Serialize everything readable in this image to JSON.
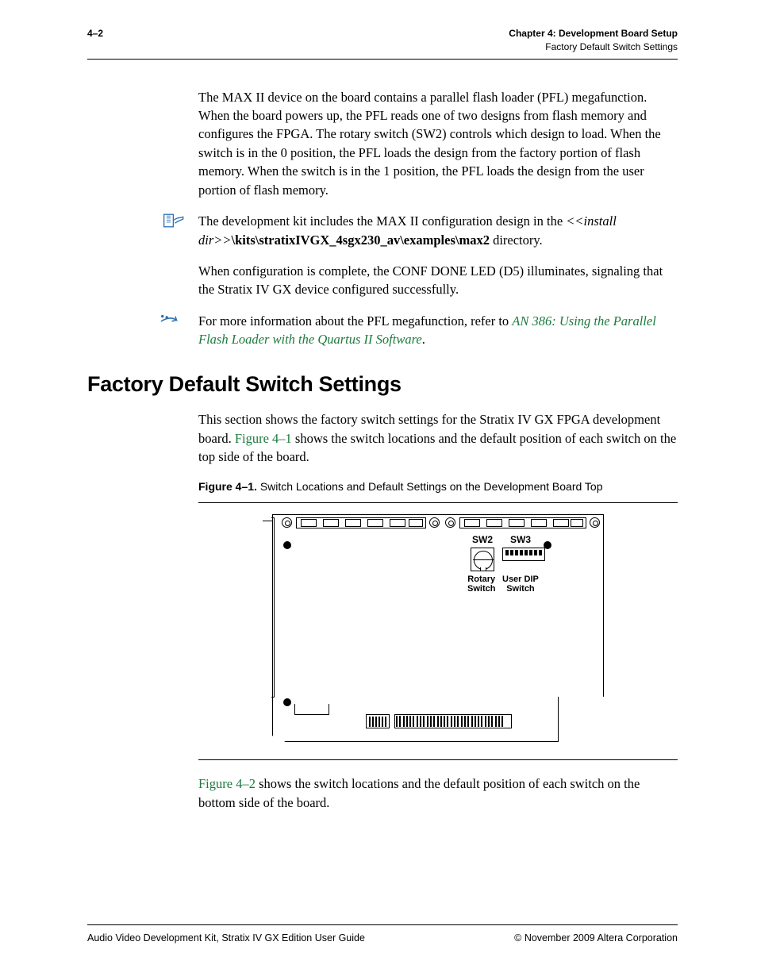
{
  "header": {
    "page_num": "4–2",
    "chapter": "Chapter 4:  Development Board Setup",
    "section_crumb": "Factory Default Switch Settings"
  },
  "paragraphs": {
    "p1": "The MAX II device on the board contains a parallel flash loader (PFL) megafunction. When the board powers up, the PFL reads one of two designs from flash memory and configures the FPGA. The rotary switch (SW2) controls which design to load. When the switch is in the 0 position, the PFL loads the design from the factory portion of flash memory. When the switch is in the 1 position, the PFL loads the design from the user portion of flash memory.",
    "note1_a": "The development kit includes the MAX II configuration design in the ",
    "note1_b": "<install dir>",
    "note1_c": "\\kits\\stratixIVGX_4sgx230_av\\examples\\max2",
    "note1_d": " directory.",
    "p2": "When configuration is complete, the CONF DONE LED (D5) illuminates, signaling that the Stratix IV GX device configured successfully.",
    "note2_a": "For more information about the PFL megafunction, refer to ",
    "note2_link": "AN 386: Using the Parallel Flash Loader with the Quartus II Software",
    "note2_b": "."
  },
  "section": {
    "title": "Factory Default Switch Settings",
    "intro_a": "This section shows the factory switch settings for the Stratix IV GX FPGA development board. ",
    "intro_link": "Figure 4–1",
    "intro_b": " shows the switch locations and the default position of each switch on the top side of the board.",
    "fig_num": "Figure 4–1.",
    "fig_caption": "Switch Locations and Default Settings on the Development Board Top",
    "after_a_link": "Figure 4–2",
    "after_a": " shows the switch locations and the default position of each switch on the bottom side of the board."
  },
  "board": {
    "sw2_label": "SW2",
    "sw2_sub1": "Rotary",
    "sw2_sub2": "Switch",
    "sw3_label": "SW3",
    "sw3_sub1": "User DIP",
    "sw3_sub2": "Switch"
  },
  "footer": {
    "left": "Audio Video Development Kit, Stratix IV GX Edition User Guide",
    "right": "© November 2009   Altera Corporation"
  }
}
